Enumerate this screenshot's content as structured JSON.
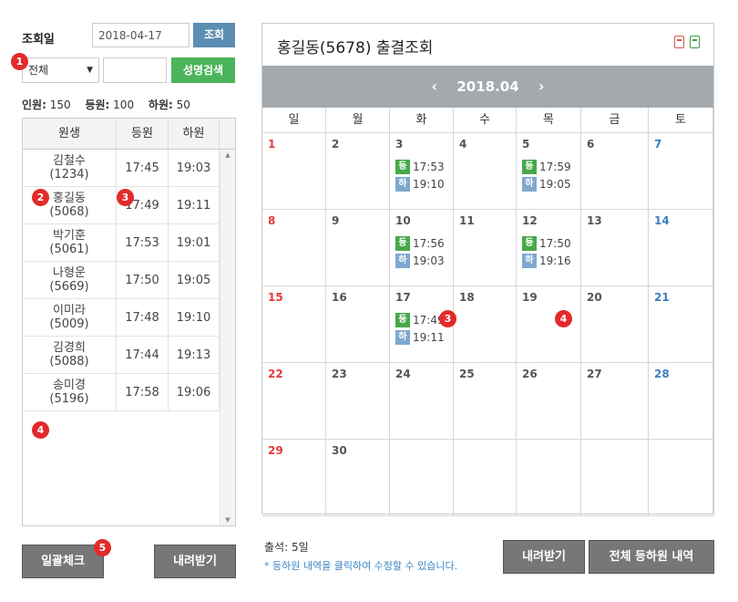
{
  "query": {
    "date_label": "조회일",
    "date_value": "2018-04-17",
    "search_button": "조회",
    "filter_value": "전체",
    "name_input_value": "",
    "name_search_button": "성명검색"
  },
  "stats": {
    "total_label": "인원:",
    "total": "150",
    "in_label": "등원:",
    "in": "100",
    "out_label": "하원:",
    "out": "50"
  },
  "table": {
    "headers": [
      "원생",
      "등원",
      "하원"
    ],
    "rows": [
      {
        "name": "김철수",
        "id": "(1234)",
        "in": "17:45",
        "out": "19:03"
      },
      {
        "name": "홍길동",
        "id": "(5068)",
        "in": "17:49",
        "out": "19:11"
      },
      {
        "name": "박기훈",
        "id": "(5061)",
        "in": "17:53",
        "out": "19:01"
      },
      {
        "name": "나형운",
        "id": "(5669)",
        "in": "17:50",
        "out": "19:05"
      },
      {
        "name": "이미라",
        "id": "(5009)",
        "in": "17:48",
        "out": "19:10"
      },
      {
        "name": "김경희",
        "id": "(5088)",
        "in": "17:44",
        "out": "19:13"
      },
      {
        "name": "송미경",
        "id": "(5196)",
        "in": "17:58",
        "out": "19:06"
      }
    ]
  },
  "buttons": {
    "bulk_check": "일괄체크",
    "download_left": "내려받기",
    "download_right": "내려받기",
    "all_history": "전체 등하원 내역"
  },
  "calendar": {
    "title": "홍길동(5678) 출결조회",
    "month": "2018.04",
    "prev": "‹",
    "next": "›",
    "weekdays": [
      "일",
      "월",
      "화",
      "수",
      "목",
      "금",
      "토"
    ],
    "in_tag": "등",
    "out_tag": "하",
    "weeks": [
      [
        {
          "d": "1"
        },
        {
          "d": "2"
        },
        {
          "d": "3",
          "in": "17:53",
          "out": "19:10"
        },
        {
          "d": "4"
        },
        {
          "d": "5",
          "in": "17:59",
          "out": "19:05"
        },
        {
          "d": "6"
        },
        {
          "d": "7"
        }
      ],
      [
        {
          "d": "8"
        },
        {
          "d": "9"
        },
        {
          "d": "10",
          "in": "17:56",
          "out": "19:03"
        },
        {
          "d": "11"
        },
        {
          "d": "12",
          "in": "17:50",
          "out": "19:16"
        },
        {
          "d": "13"
        },
        {
          "d": "14"
        }
      ],
      [
        {
          "d": "15"
        },
        {
          "d": "16"
        },
        {
          "d": "17",
          "in": "17:49",
          "out": "19:11"
        },
        {
          "d": "18"
        },
        {
          "d": "19"
        },
        {
          "d": "20"
        },
        {
          "d": "21"
        }
      ],
      [
        {
          "d": "22"
        },
        {
          "d": "23"
        },
        {
          "d": "24"
        },
        {
          "d": "25"
        },
        {
          "d": "26"
        },
        {
          "d": "27"
        },
        {
          "d": "28"
        }
      ],
      [
        {
          "d": "29"
        },
        {
          "d": "30"
        },
        {
          "d": ""
        },
        {
          "d": ""
        },
        {
          "d": ""
        },
        {
          "d": ""
        },
        {
          "d": ""
        }
      ]
    ],
    "icon_colors": {
      "pdf": "#d9534f",
      "excel": "#3c9a3f"
    }
  },
  "footer": {
    "attendance": "출석: 5일",
    "note": "* 등하원 내역을 클릭하여 수정할 수 있습니다."
  },
  "badges": [
    "1",
    "2",
    "3",
    "4",
    "5"
  ]
}
